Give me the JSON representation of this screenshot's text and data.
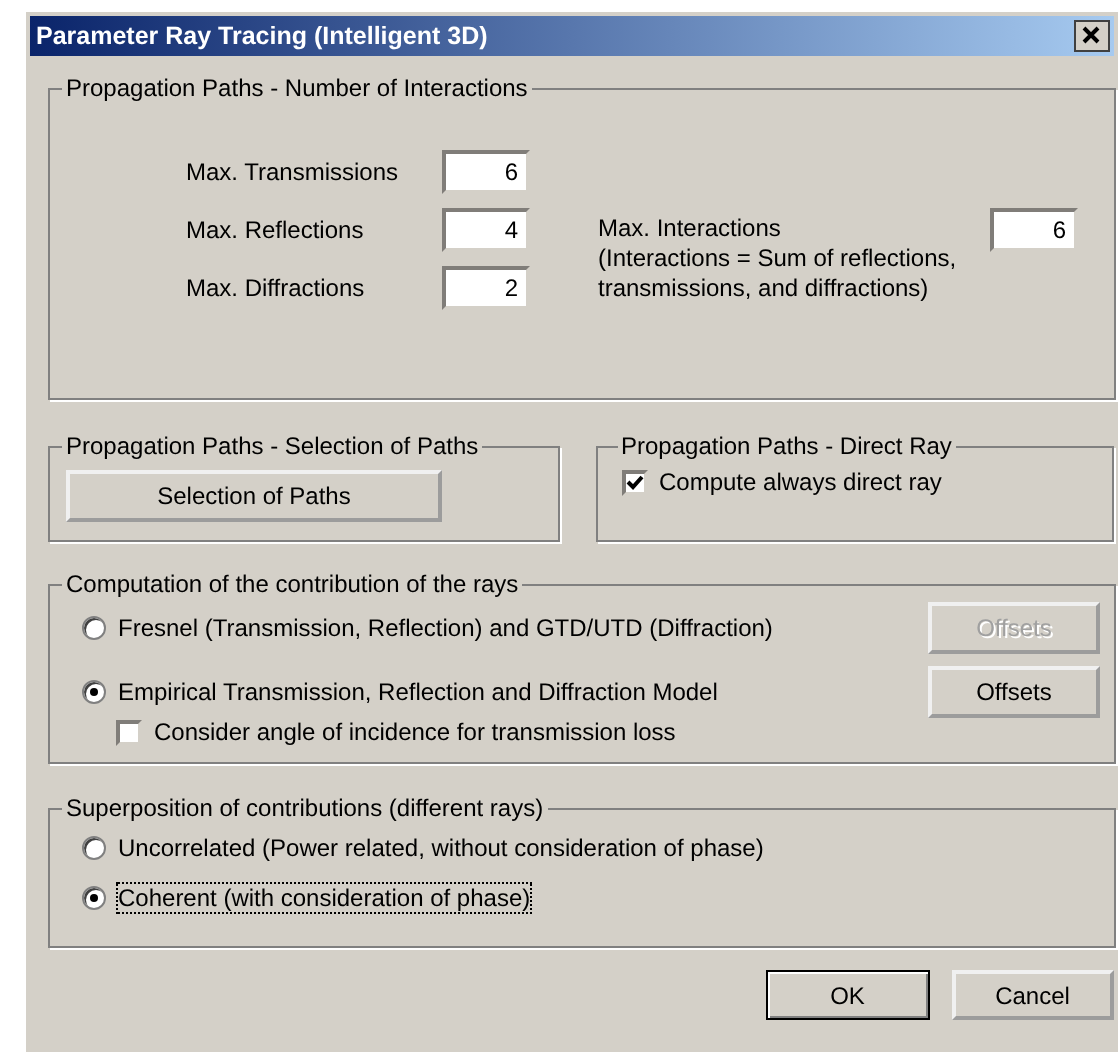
{
  "window": {
    "title": "Parameter Ray Tracing (Intelligent 3D)"
  },
  "interactions": {
    "title": "Propagation Paths - Number of Interactions",
    "fields": [
      {
        "label": "Max. Transmissions",
        "value": "6"
      },
      {
        "label": "Max. Reflections",
        "value": "4"
      },
      {
        "label": "Max. Diffractions",
        "value": "2"
      }
    ],
    "max_interactions": {
      "label": "Max. Interactions",
      "note": "(Interactions = Sum of reflections, transmissions, and diffractions)",
      "value": "6"
    }
  },
  "path_selection": {
    "title": "Propagation Paths - Selection of Paths",
    "button": "Selection of Paths"
  },
  "direct_ray": {
    "title": "Propagation Paths - Direct Ray",
    "checkbox": {
      "label": "Compute always direct ray",
      "checked": true
    }
  },
  "computation": {
    "title": "Computation of the contribution of the rays",
    "options": [
      {
        "label": "Fresnel (Transmission, Reflection) and GTD/UTD (Diffraction)",
        "selected": false,
        "button": {
          "label": "Offsets",
          "disabled": true
        }
      },
      {
        "label": "Empirical Transmission, Reflection and Diffraction Model",
        "selected": true,
        "button": {
          "label": "Offsets",
          "disabled": false
        }
      }
    ],
    "incidence": {
      "label": "Consider angle of incidence for transmission loss",
      "checked": false
    }
  },
  "superposition": {
    "title": "Superposition of contributions (different rays)",
    "options": [
      {
        "label": "Uncorrelated (Power related, without consideration of phase)",
        "selected": false,
        "focused": false
      },
      {
        "label": "Coherent (with consideration of phase)",
        "selected": true,
        "focused": true
      }
    ]
  },
  "buttons": [
    {
      "label": "OK",
      "default": true
    },
    {
      "label": "Cancel",
      "default": false
    }
  ]
}
